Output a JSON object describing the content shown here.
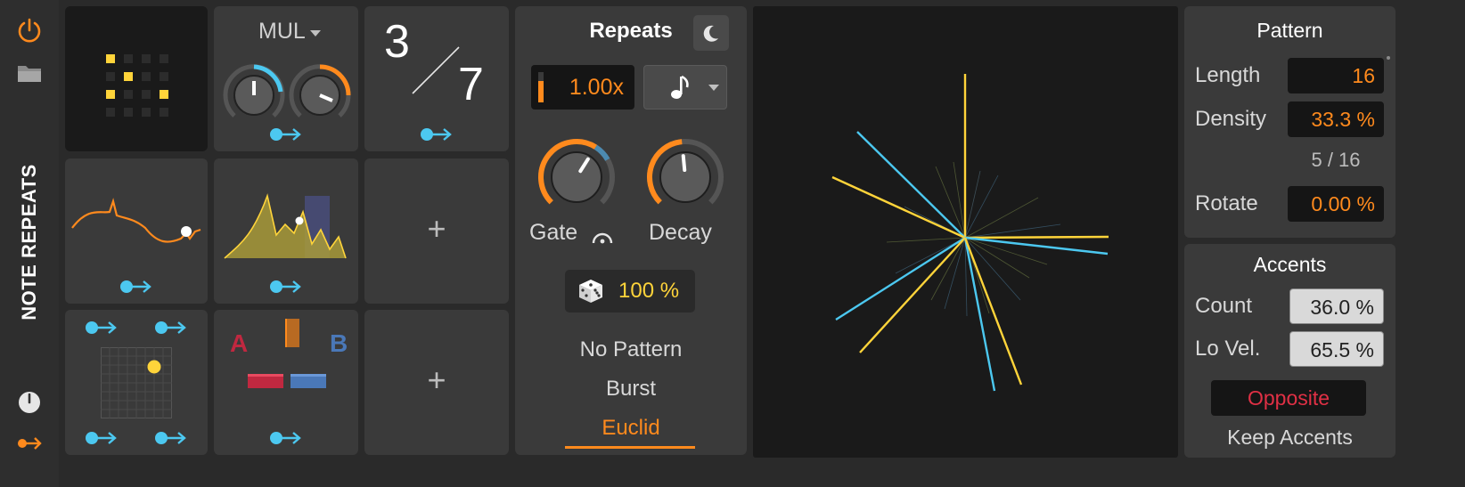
{
  "device": {
    "title": "NOTE REPEATS"
  },
  "colors": {
    "accent": "#ff8a1d",
    "cyan": "#4cc8f0",
    "yellow": "#ffd43a",
    "red": "#e03045",
    "panel": "#3a3a3a",
    "dark": "#1a1a1a"
  },
  "left_strip": {
    "icons": [
      "power-icon",
      "folder-icon",
      "meter-icon",
      "modulation-arrow-icon"
    ]
  },
  "modulators": {
    "mul_label": "MUL",
    "ratio_numerator": "3",
    "ratio_denominator": "7",
    "add_label": "+",
    "ab_a": "A",
    "ab_b": "B"
  },
  "repeats": {
    "title": "Repeats",
    "rate_value": "1.00x",
    "gate_label": "Gate",
    "decay_label": "Decay",
    "chance_value": "100 %",
    "gate_level": 0.62,
    "decay_level": 0.48,
    "modes": [
      "No Pattern",
      "Burst",
      "Euclid"
    ],
    "selected_mode": "Euclid"
  },
  "pattern": {
    "title": "Pattern",
    "length_label": "Length",
    "length_value": "16",
    "density_label": "Density",
    "density_value": "33.3 %",
    "density_fraction": "5 / 16",
    "rotate_label": "Rotate",
    "rotate_value": "0.00 %"
  },
  "accents": {
    "title": "Accents",
    "count_label": "Count",
    "count_value": "36.0 %",
    "lovel_label": "Lo Vel.",
    "lovel_value": "65.5 %",
    "opposite_label": "Opposite",
    "keep_label": "Keep Accents"
  }
}
